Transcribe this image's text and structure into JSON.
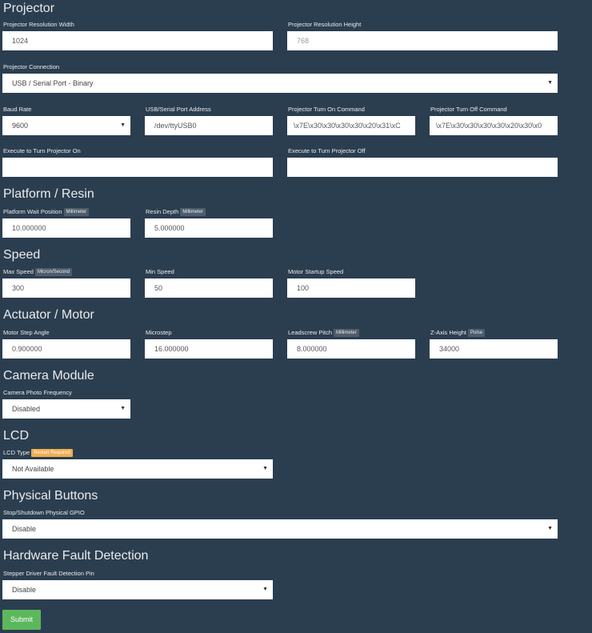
{
  "sections": {
    "projector": "Projector",
    "platform": "Platform / Resin",
    "speed": "Speed",
    "actuator": "Actuator / Motor",
    "camera": "Camera Module",
    "lcd": "LCD",
    "buttons": "Physical Buttons",
    "fault": "Hardware Fault Detection"
  },
  "projector": {
    "res_width_label": "Projector Resolution Width",
    "res_width_value": "1024",
    "res_height_label": "Projector Resolution Height",
    "res_height_value": "768",
    "connection_label": "Projector Connection",
    "connection_value": "USB / Serial Port - Binary",
    "baud_label": "Baud Rate",
    "baud_value": "9600",
    "port_label": "USB/Serial Port Address",
    "port_value": "/dev/ttyUSB0",
    "on_cmd_label": "Projector Turn On Command",
    "on_cmd_value": "\\x7E\\x30\\x30\\x30\\x30\\x20\\x31\\xC",
    "off_cmd_label": "Projector Turn Off Command",
    "off_cmd_value": "\\x7E\\x30\\x30\\x30\\x30\\x20\\x30\\x0",
    "exec_on_label": "Execute to Turn Projector On",
    "exec_off_label": "Execute to Turn Projector Off"
  },
  "platform": {
    "wait_label": "Platform Wait Position",
    "wait_badge": "Millimeter",
    "wait_value": "10.000000",
    "depth_label": "Resin Depth",
    "depth_badge": "Millimeter",
    "depth_value": "5.000000"
  },
  "speed": {
    "max_label": "Max Speed",
    "max_badge": "Micron/Second",
    "max_value": "300",
    "min_label": "Min Speed",
    "min_value": "50",
    "startup_label": "Motor Startup Speed",
    "startup_value": "100"
  },
  "actuator": {
    "step_label": "Motor Step Angle",
    "step_value": "0.900000",
    "micro_label": "Microstep",
    "micro_value": "16.000000",
    "pitch_label": "Leadscrew Pitch",
    "pitch_badge": "Millimeter",
    "pitch_value": "8.000000",
    "zaxis_label": "Z-Axis Height",
    "zaxis_badge": "Pulse",
    "zaxis_value": "34000"
  },
  "camera": {
    "freq_label": "Camera Photo Frequency",
    "freq_value": "Disabled"
  },
  "lcd": {
    "type_label": "LCD Type",
    "type_badge": "Restart Required",
    "type_value": "Not Available"
  },
  "buttons": {
    "gpio_label": "Stop/Shutdown Physical GPIO",
    "gpio_value": "Disable"
  },
  "fault": {
    "pin_label": "Stepper Driver Fault Detection Pin",
    "pin_value": "Disable"
  },
  "submit_label": "Submit",
  "colors": {
    "background": "#2b3e50",
    "badge": "#4e5d6c",
    "warn_badge": "#f0ad4e",
    "submit": "#5cb85c"
  }
}
